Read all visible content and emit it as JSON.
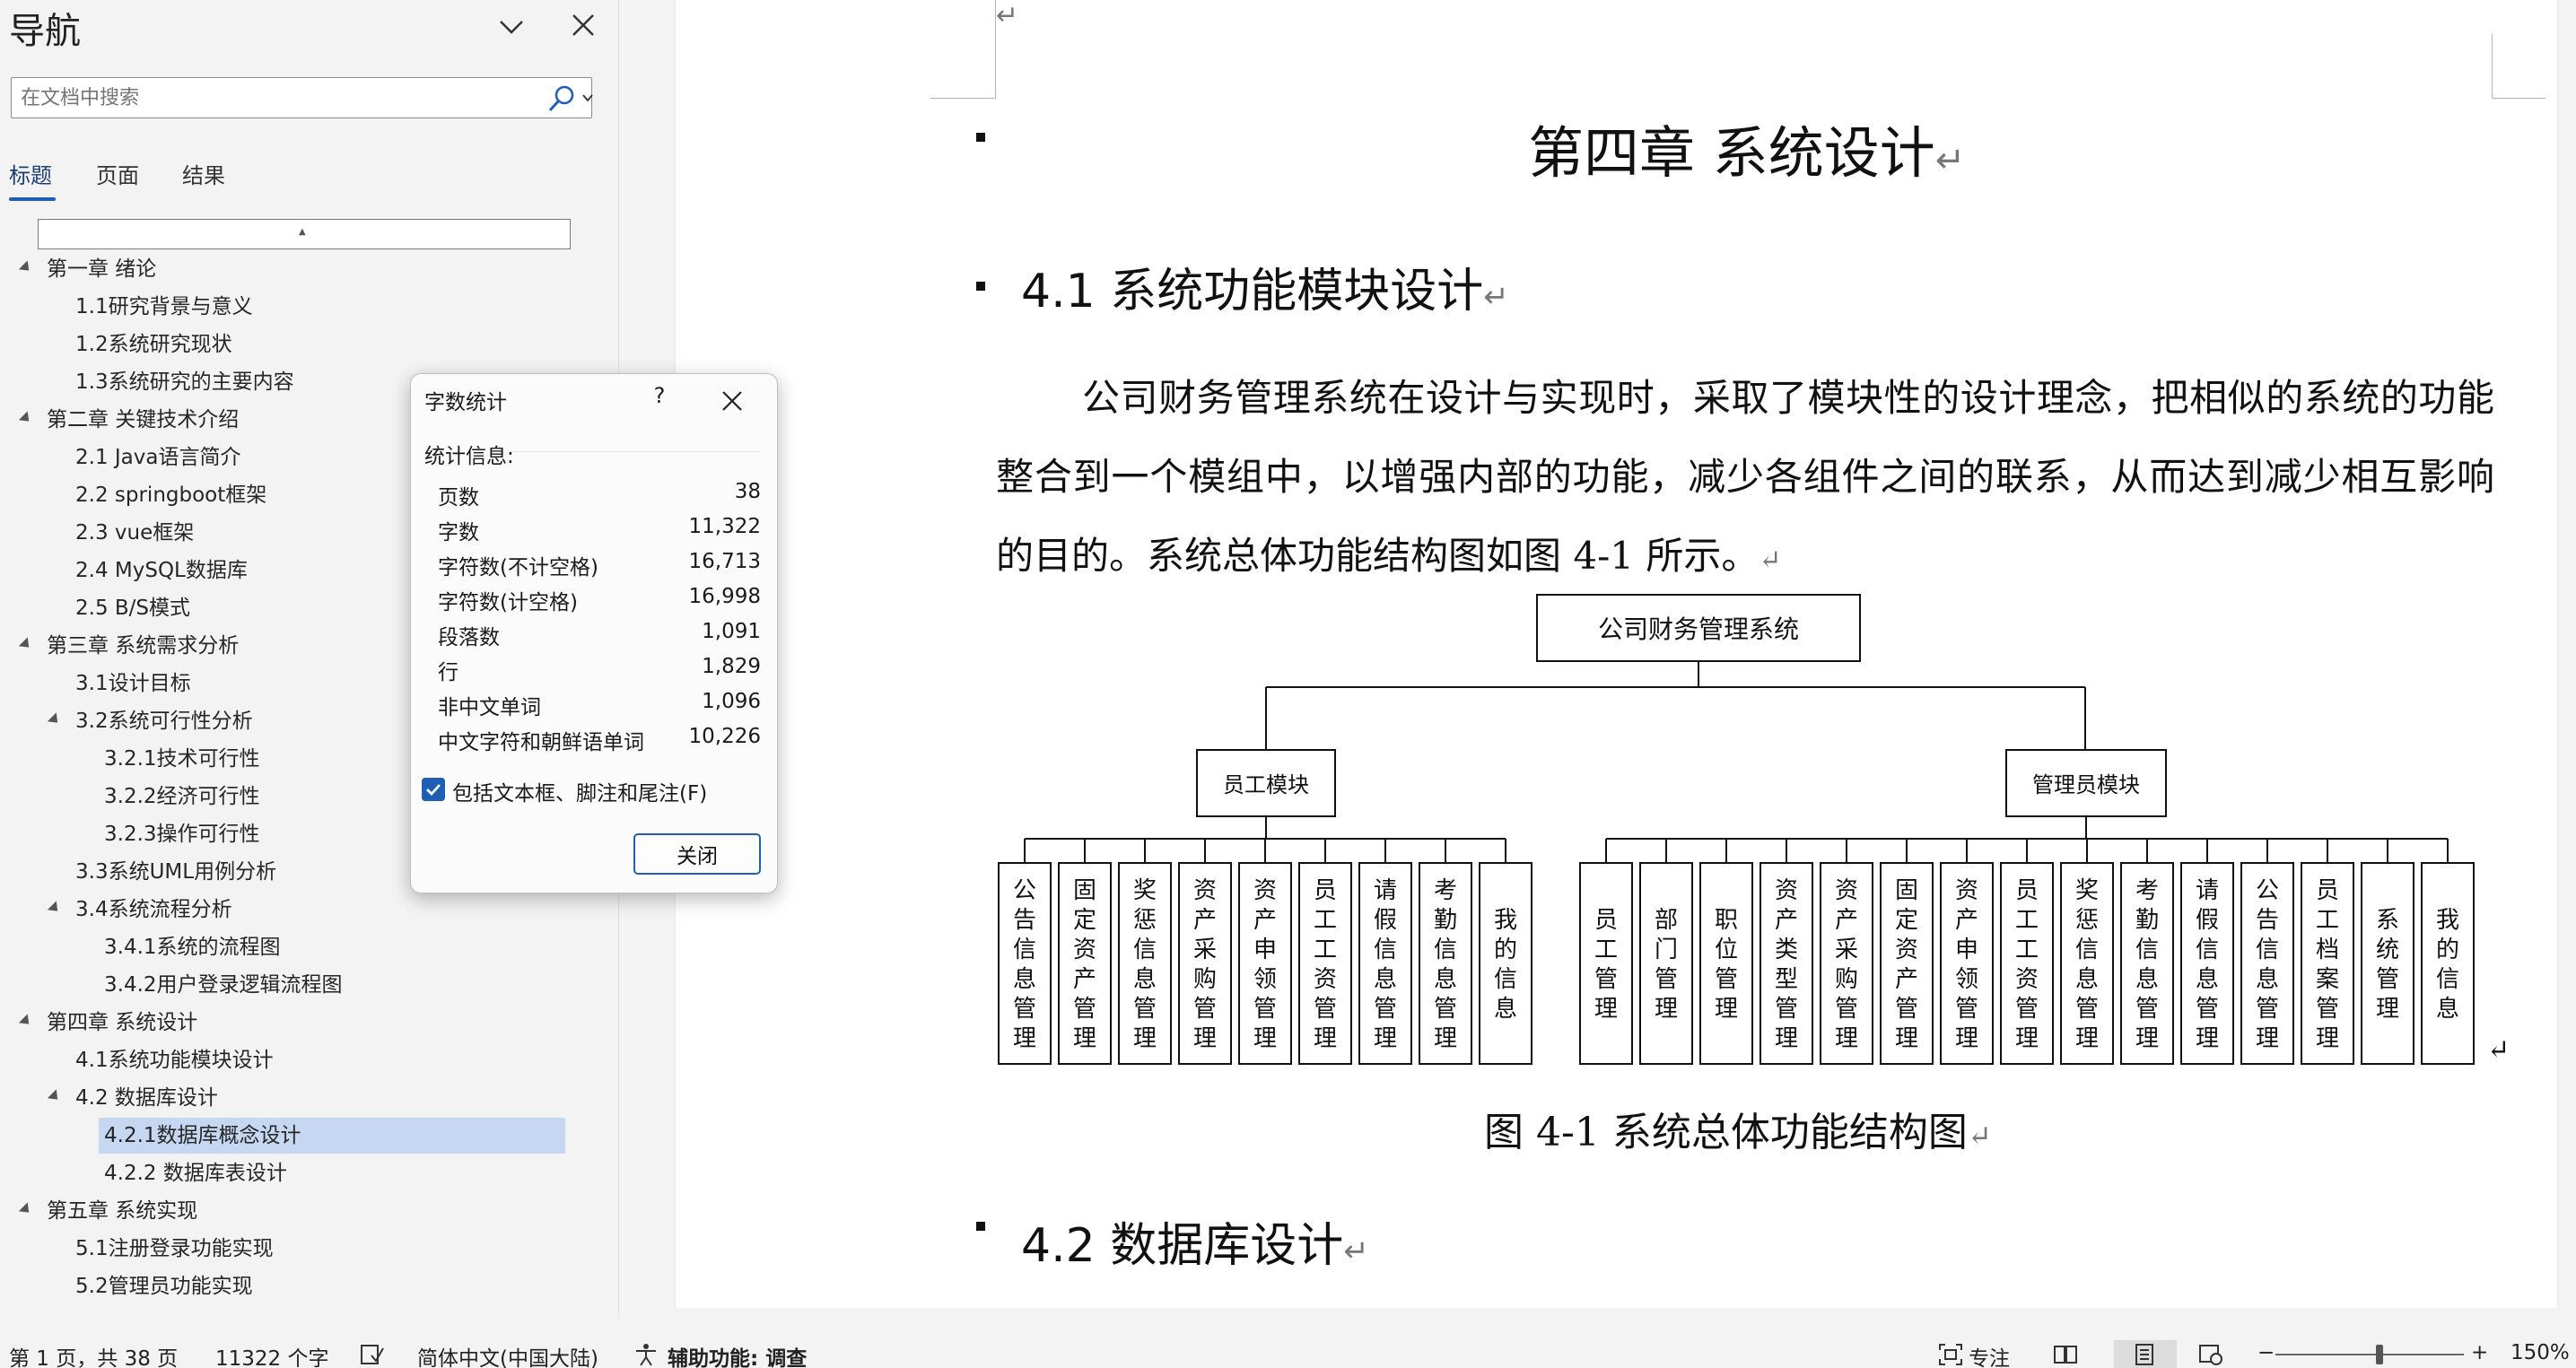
{
  "nav": {
    "title": "导航",
    "search_placeholder": "在文档中搜索",
    "tabs": [
      {
        "label": "标题"
      },
      {
        "label": "页面"
      },
      {
        "label": "结果"
      }
    ],
    "scroll_marker": "▲",
    "tree": [
      {
        "label": "第一章 绪论",
        "level": 0,
        "expanded": true
      },
      {
        "label": "1.1研究背景与意义",
        "level": 1
      },
      {
        "label": "1.2系统研究现状",
        "level": 1
      },
      {
        "label": "1.3系统研究的主要内容",
        "level": 1
      },
      {
        "label": "第二章 关键技术介绍",
        "level": 0,
        "expanded": true
      },
      {
        "label": "2.1 Java语言简介",
        "level": 1
      },
      {
        "label": "2.2 springboot框架",
        "level": 1
      },
      {
        "label": "2.3 vue框架",
        "level": 1
      },
      {
        "label": "2.4 MySQL数据库",
        "level": 1
      },
      {
        "label": "2.5 B/S模式",
        "level": 1
      },
      {
        "label": "第三章 系统需求分析",
        "level": 0,
        "expanded": true
      },
      {
        "label": "3.1设计目标",
        "level": 1
      },
      {
        "label": "3.2系统可行性分析",
        "level": 1,
        "expanded": true
      },
      {
        "label": "3.2.1技术可行性",
        "level": 2
      },
      {
        "label": "3.2.2经济可行性",
        "level": 2
      },
      {
        "label": "3.2.3操作可行性",
        "level": 2
      },
      {
        "label": "3.3系统UML用例分析",
        "level": 1
      },
      {
        "label": "3.4系统流程分析",
        "level": 1,
        "expanded": true
      },
      {
        "label": "3.4.1系统的流程图",
        "level": 2
      },
      {
        "label": "3.4.2用户登录逻辑流程图",
        "level": 2
      },
      {
        "label": "第四章 系统设计",
        "level": 0,
        "expanded": true
      },
      {
        "label": "4.1系统功能模块设计",
        "level": 1
      },
      {
        "label": "4.2 数据库设计",
        "level": 1,
        "expanded": true
      },
      {
        "label": "4.2.1数据库概念设计",
        "level": 2,
        "selected": true
      },
      {
        "label": "4.2.2 数据库表设计",
        "level": 2
      },
      {
        "label": "第五章 系统实现",
        "level": 0,
        "expanded": true
      },
      {
        "label": "5.1注册登录功能实现",
        "level": 1
      },
      {
        "label": "5.2管理员功能实现",
        "level": 1
      }
    ]
  },
  "dialog": {
    "title": "字数统计",
    "help": "?",
    "section": "统计信息:",
    "stats": [
      {
        "label": "页数",
        "value": "38"
      },
      {
        "label": "字数",
        "value": "11,322"
      },
      {
        "label": "字符数(不计空格)",
        "value": "16,713"
      },
      {
        "label": "字符数(计空格)",
        "value": "16,998"
      },
      {
        "label": "段落数",
        "value": "1,091"
      },
      {
        "label": "行",
        "value": "1,829"
      },
      {
        "label": "非中文单词",
        "value": "1,096"
      },
      {
        "label": "中文字符和朝鲜语单词",
        "value": "10,226"
      }
    ],
    "checkbox_label": "包括文本框、脚注和尾注(F)",
    "checkbox_checked": true,
    "button": "关闭"
  },
  "document": {
    "chapter_title": "第四章  系统设计",
    "h41": "4.1 系统功能模块设计",
    "paragraph": "公司财务管理系统在设计与实现时，采取了模块性的设计理念，把相似的系统的功能整合到一个模组中，以增强内部的功能，减少各组件之间的联系，从而达到减少相互影响的目的。系统总体功能结构图如图 4-1 所示。",
    "figure": {
      "root": "公司财务管理系统",
      "employee_module": "员工模块",
      "admin_module": "管理员模块",
      "employee_leaves": [
        "公告信息管理",
        "固定资产管理",
        "奖惩信息管理",
        "资产采购管理",
        "资产申领管理",
        "员工工资管理",
        "请假信息管理",
        "考勤信息管理",
        "我的信息"
      ],
      "admin_leaves": [
        "员工管理",
        "部门管理",
        "职位管理",
        "资产类型管理",
        "资产采购管理",
        "固定资产管理",
        "资产申领管理",
        "员工工资管理",
        "奖惩信息管理",
        "考勤信息管理",
        "请假信息管理",
        "公告信息管理",
        "员工档案管理",
        "系统管理",
        "我的信息"
      ]
    },
    "caption": "图 4-1  系统总体功能结构图",
    "h42": "4.2  数据库设计",
    "para_mark": "↵"
  },
  "statusbar": {
    "page": "第 1 页，共 38 页",
    "words": "11322 个字",
    "language": "简体中文(中国大陆)",
    "accessibility": "辅助功能: 调查",
    "focus": "专注",
    "zoom_minus": "−",
    "zoom_plus": "+",
    "zoom": "150%"
  },
  "colors": {
    "accent": "#1e5fb4",
    "selected_row": "#c6d7f1",
    "panel_bg": "#f3f3f3"
  }
}
